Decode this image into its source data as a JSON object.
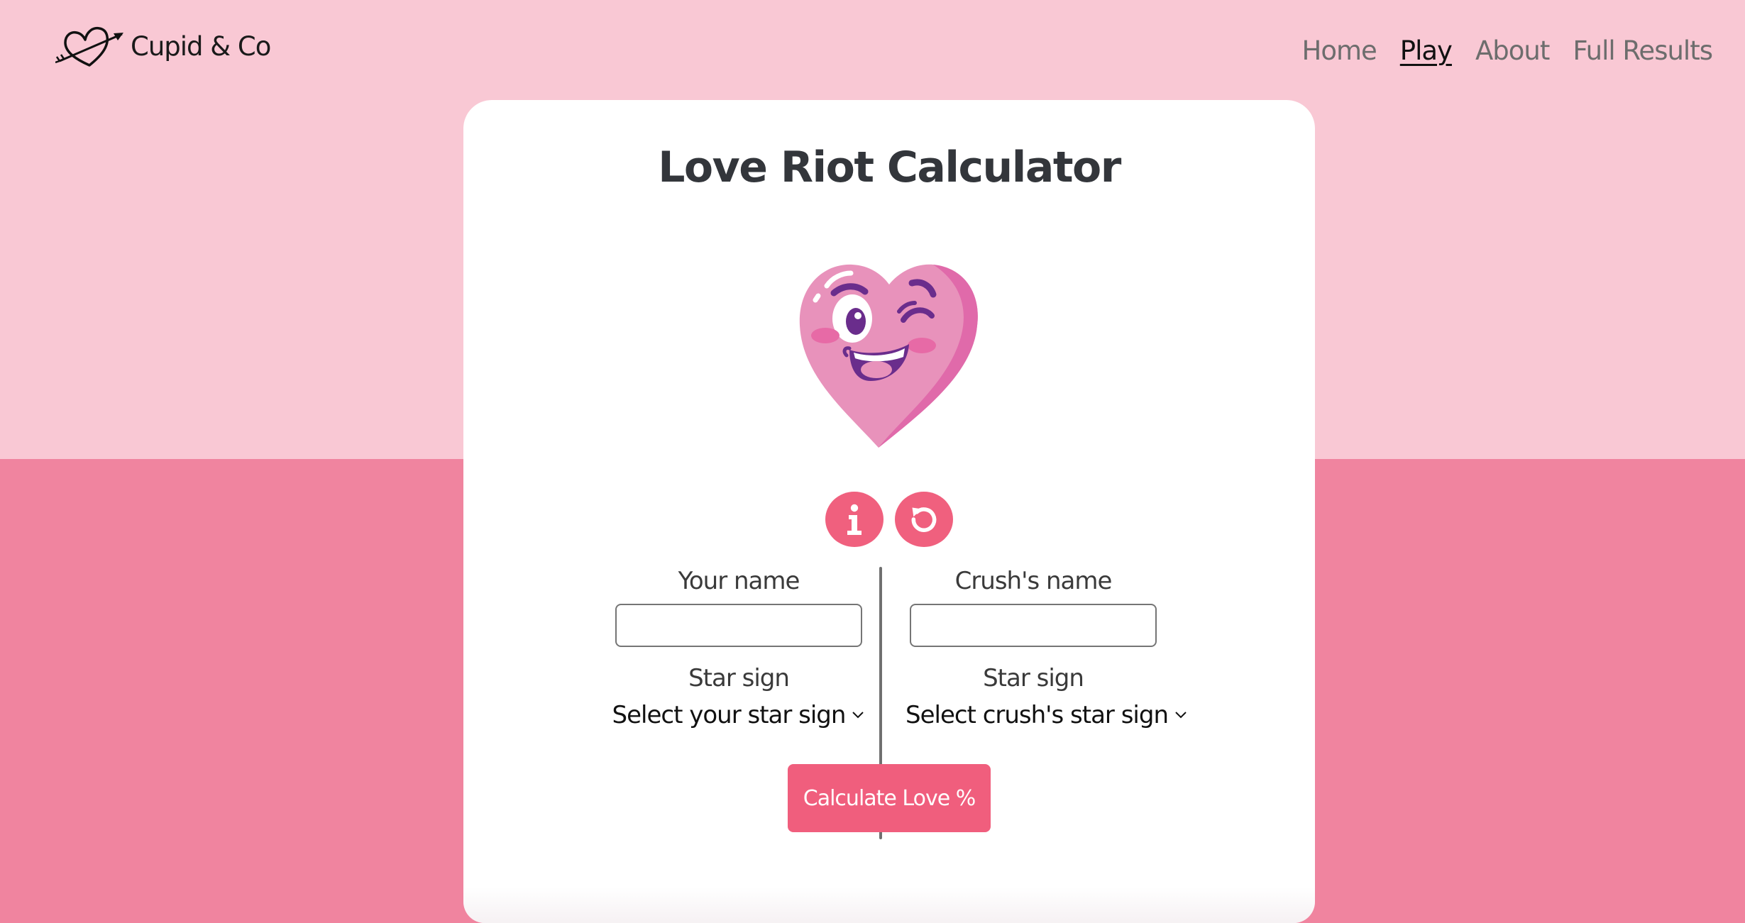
{
  "brand": {
    "name": "Cupid & Co",
    "logo_icon": "heart-arrow-icon"
  },
  "nav": {
    "items": [
      {
        "label": "Home",
        "active": false
      },
      {
        "label": "Play",
        "active": true
      },
      {
        "label": "About",
        "active": false
      },
      {
        "label": "Full Results",
        "active": false
      }
    ]
  },
  "card": {
    "title": "Love Riot Calculator",
    "mascot_icon": "winking-heart-mascot",
    "info_icon": "info-icon",
    "reset_icon": "reset-icon",
    "your": {
      "name_label": "Your name",
      "name_value": "",
      "sign_label": "Star sign",
      "sign_select": "Select your star sign"
    },
    "crush": {
      "name_label": "Crush's name",
      "name_value": "",
      "sign_label": "Star sign",
      "sign_select": "Select crush's star sign"
    },
    "calculate_label": "Calculate Love %"
  },
  "colors": {
    "bg_top": "#f9c8d4",
    "bg_bottom": "#f0849f",
    "accent": "#f05e7d",
    "card": "#ffffff"
  }
}
